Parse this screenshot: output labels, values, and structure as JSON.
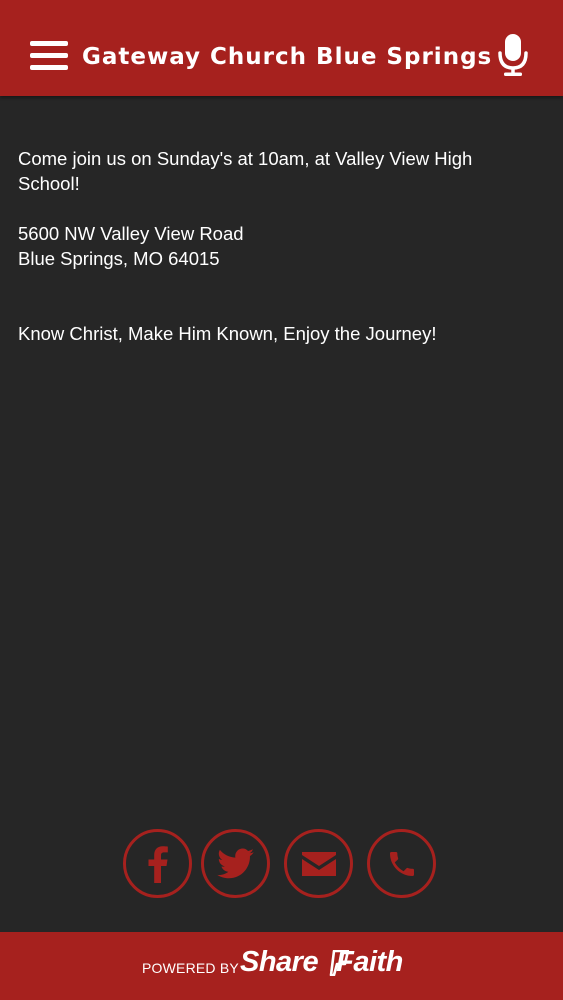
{
  "header": {
    "title": "Gateway Church Blue Springs",
    "menu_icon": "hamburger-menu-icon",
    "mic_icon": "microphone-icon"
  },
  "content": {
    "intro": " Come join us on Sunday's at 10am, at Valley View High School!",
    "address_line1": "5600 NW Valley View Road",
    "address_line2": "Blue Springs, MO 64015",
    "tagline": "Know Christ, Make Him Known, Enjoy the Journey!"
  },
  "social": [
    {
      "name": "facebook",
      "icon": "facebook-icon"
    },
    {
      "name": "twitter",
      "icon": "twitter-icon"
    },
    {
      "name": "email",
      "icon": "envelope-icon"
    },
    {
      "name": "phone",
      "icon": "phone-icon"
    }
  ],
  "footer": {
    "powered_by": "POWERED BY",
    "brand_part1": "Share",
    "brand_part2": "Faith"
  },
  "colors": {
    "accent": "#a6211e",
    "background": "#262626",
    "text": "#ffffff"
  }
}
